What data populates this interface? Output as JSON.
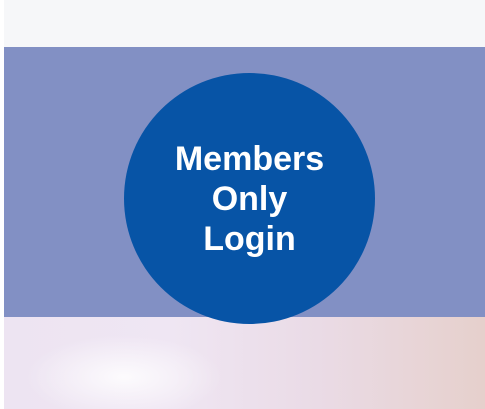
{
  "login_button": {
    "lines": [
      "Members",
      "Only",
      "Login"
    ]
  },
  "colors": {
    "top_strip": "#f6f7f9",
    "banner": "#8290c4",
    "circle": "#0754a6",
    "text": "#ffffff"
  }
}
